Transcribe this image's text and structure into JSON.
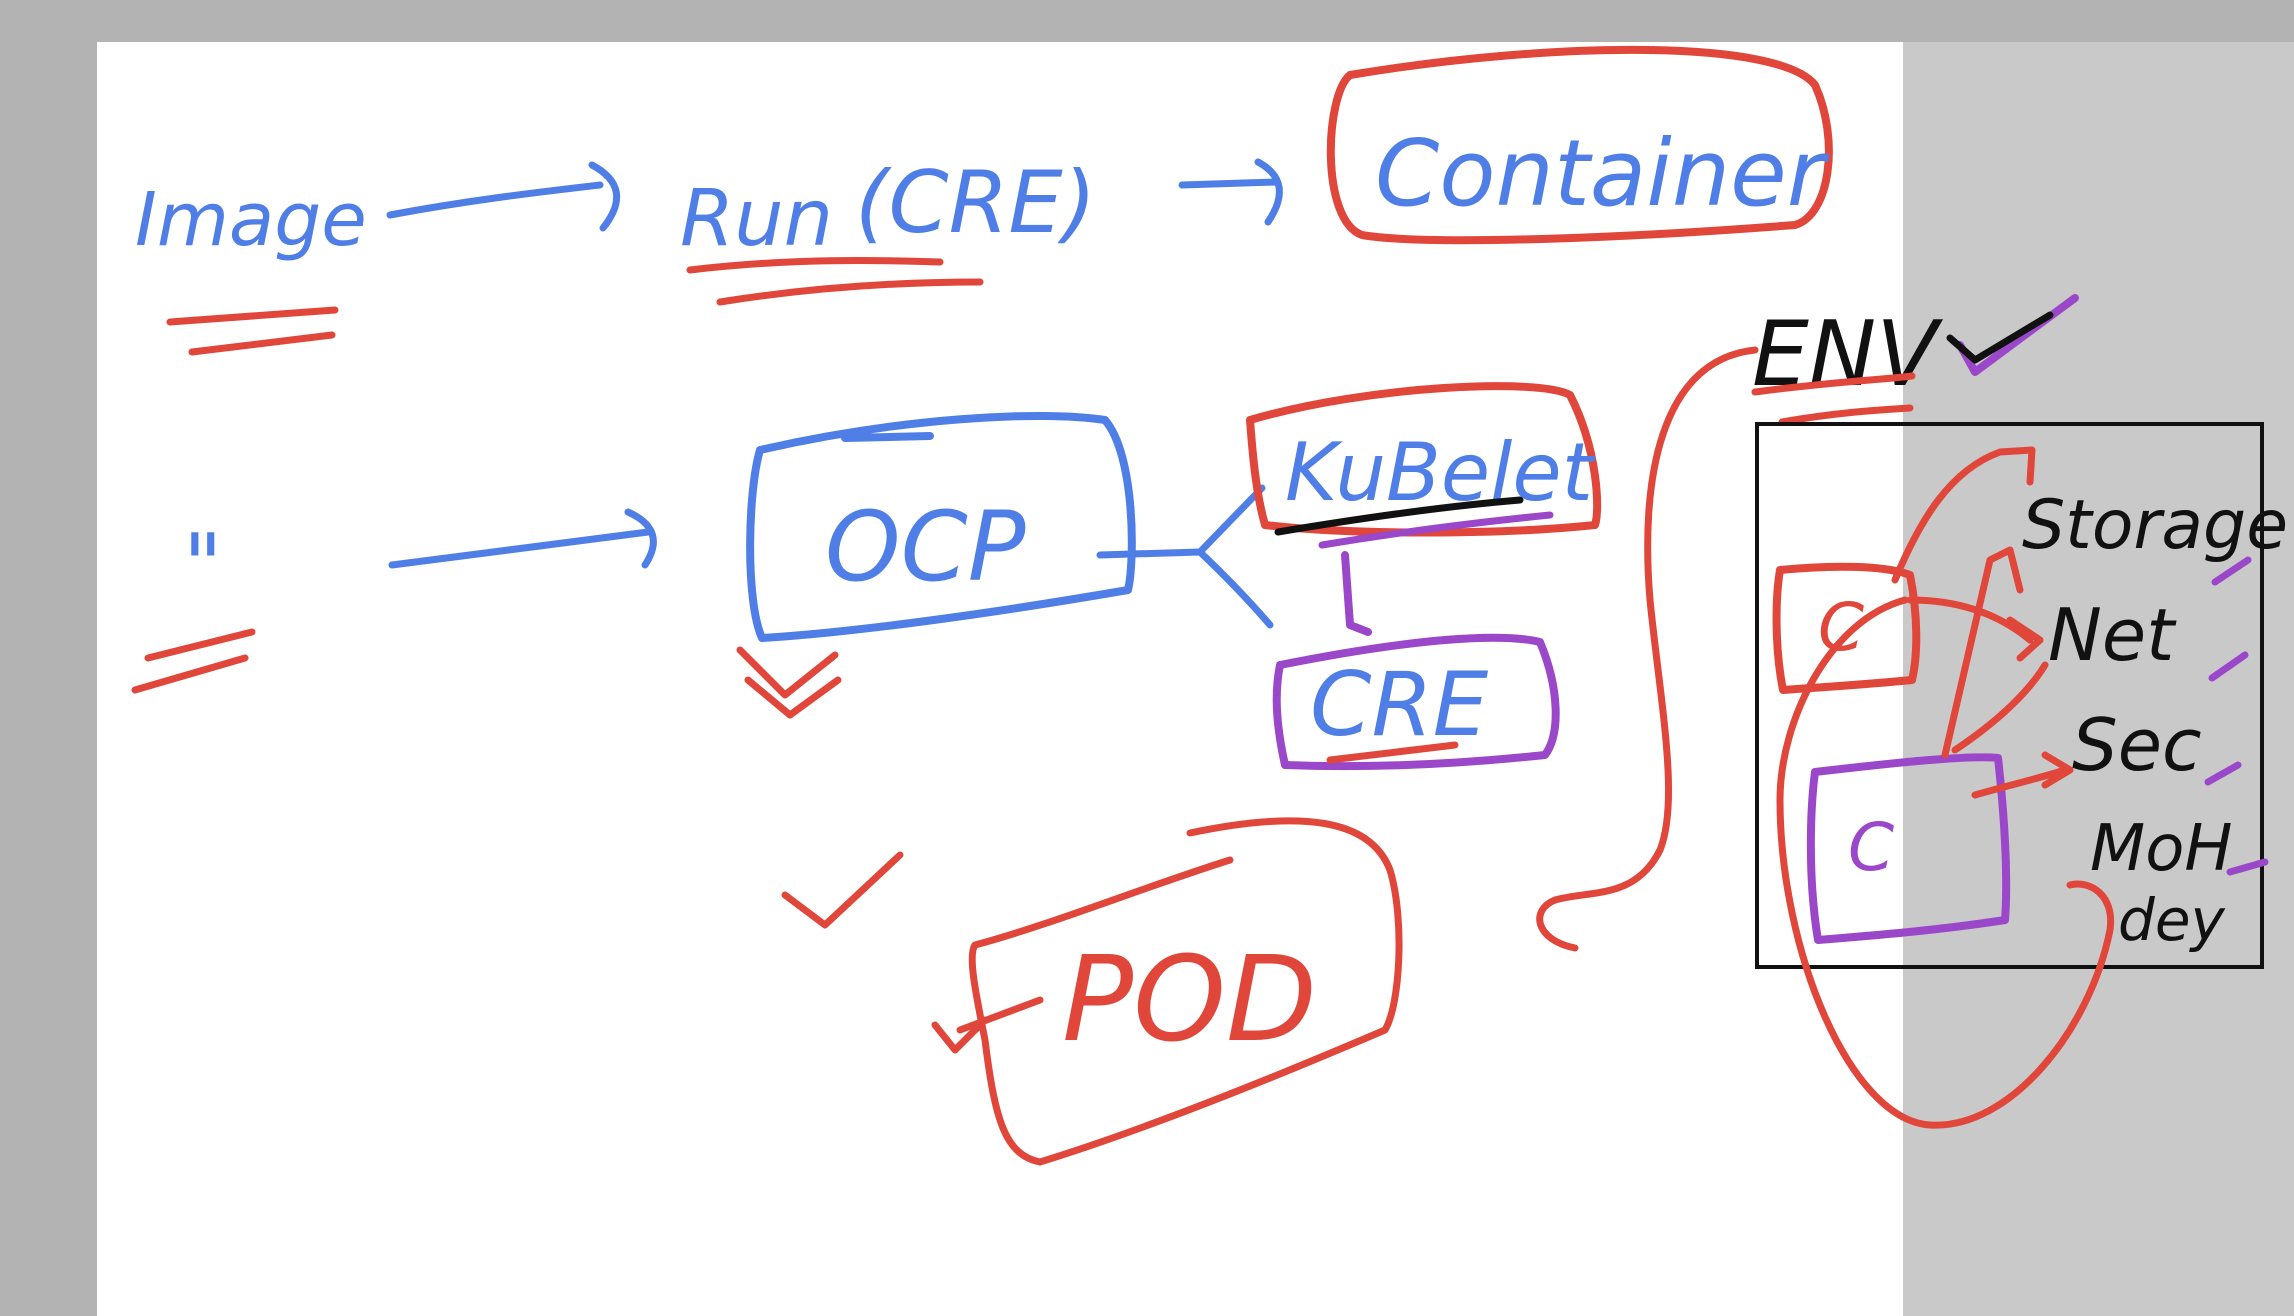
{
  "canvas": {
    "background_color": "#b3b3b3",
    "page_color": "#ffffff",
    "ink_colors": {
      "blue": "#4f7fe6",
      "red": "#e0473a",
      "purple": "#9b47c9",
      "black": "#111111"
    }
  },
  "row1": {
    "image_label": "Image",
    "run_label": "Run",
    "cre_label": "(CRE)",
    "container_label": "Container"
  },
  "row2": {
    "ditto_label": "\"",
    "ocp_label": "OCP",
    "kubelet_label": "KuBelet",
    "cre_label": "CRE"
  },
  "pod": {
    "label": "POD"
  },
  "env": {
    "label": "ENV",
    "container_a": "C",
    "container_b": "C",
    "items": [
      "Storage",
      "Net",
      "Sec",
      "MoH",
      "dey"
    ]
  }
}
